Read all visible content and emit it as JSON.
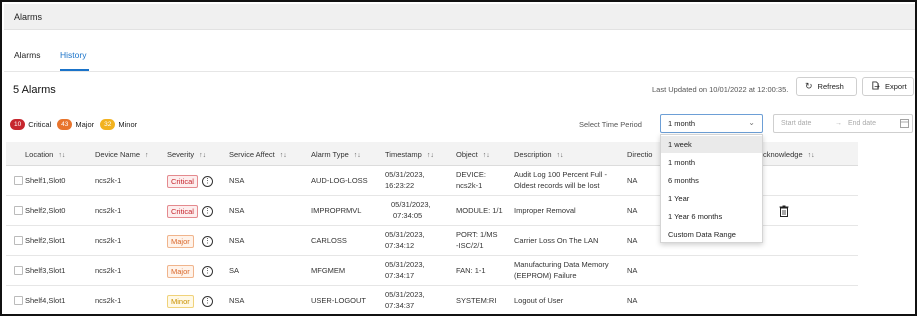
{
  "window": {
    "title": "Alarms"
  },
  "tabs": [
    {
      "label": "Alarms",
      "active": false
    },
    {
      "label": "History",
      "active": true
    }
  ],
  "summary": {
    "count_title": "5 Alarms",
    "last_updated": "Last Updated on 10/01/2022 at 12:00:35."
  },
  "toolbar": {
    "refresh_label": "Refresh",
    "refresh_icon": "refresh-icon",
    "export_label": "Export",
    "export_icon": "export-icon"
  },
  "severity_counts": [
    {
      "count": "10",
      "label": "Critical",
      "color": "#c6262e"
    },
    {
      "count": "43",
      "label": "Major",
      "color": "#e8742c"
    },
    {
      "count": "32",
      "label": "Minor",
      "color": "#f2b21e"
    }
  ],
  "time_period": {
    "label": "Select Time Period",
    "selected": "1 month",
    "options": [
      "1 week",
      "1 month",
      "6 months",
      "1 Year",
      "1 Year 6 months",
      "Custom Data Range"
    ],
    "highlighted_index": 0
  },
  "date_range": {
    "start_placeholder": "Start date",
    "separator": "→",
    "end_placeholder": "End date"
  },
  "table": {
    "columns": [
      "Location",
      "Device Name",
      "Severity",
      "Service Affect",
      "Alarm Type",
      "Timestamp",
      "Object",
      "Description",
      "Direction",
      "Acknowledge"
    ],
    "direction_visible": "Directio",
    "acknowledge_visible": "cknowledge",
    "rows": [
      {
        "location": "Shelf1,Slot0",
        "device": "ncs2k-1",
        "severity": "Critical",
        "service_affect": "NSA",
        "alarm_type": "AUD-LOG-LOSS",
        "timestamp_date": "05/31/2023,",
        "timestamp_time": "16:23:22",
        "object_l1": "DEVICE:",
        "object_l2": "ncs2k-1",
        "desc_l1": "Audit Log 100 Percent Full -",
        "desc_l2": "Oldest records will be lost",
        "direction": "NA"
      },
      {
        "location": "Shelf2,Slot0",
        "device": "ncs2k-1",
        "severity": "Critical",
        "service_affect": "NSA",
        "alarm_type": "IMPROPRMVL",
        "timestamp_date": "05/31/2023,",
        "timestamp_time": "07:34:05",
        "object_l1": "MODULE: 1/1",
        "object_l2": "",
        "desc_l1": "Improper Removal",
        "desc_l2": "",
        "direction": "NA"
      },
      {
        "location": "Shelf2,Slot1",
        "device": "ncs2k-1",
        "severity": "Major",
        "service_affect": "NSA",
        "alarm_type": "CARLOSS",
        "timestamp_date": "05/31/2023,",
        "timestamp_time": "07:34:12",
        "object_l1": "PORT: 1/MS",
        "object_l2": "-ISC/2/1",
        "desc_l1": "Carrier Loss On The LAN",
        "desc_l2": "",
        "direction": "NA"
      },
      {
        "location": "Shelf3,Slot1",
        "device": "ncs2k-1",
        "severity": "Major",
        "service_affect": "SA",
        "alarm_type": "MFGMEM",
        "timestamp_date": "05/31/2023,",
        "timestamp_time": "07:34:17",
        "object_l1": "FAN: 1-1",
        "object_l2": "",
        "desc_l1": "Manufacturing Data Memory",
        "desc_l2": "(EEPROM) Failure",
        "direction": "NA"
      },
      {
        "location": "Shelf4,Slot1",
        "device": "ncs2k-1",
        "severity": "Minor",
        "service_affect": "NSA",
        "alarm_type": "USER-LOGOUT",
        "timestamp_date": "05/31/2023,",
        "timestamp_time": "07:34:37",
        "object_l1": "SYSTEM:RI",
        "object_l2": "",
        "desc_l1": "Logout of User",
        "desc_l2": "",
        "direction": "NA"
      }
    ]
  },
  "icons": {
    "sort": "sort-icon",
    "info": "info-circle-icon",
    "dropdown": "chevron-down-icon",
    "calendar": "calendar-icon",
    "acknowledge_action": "trash-icon"
  }
}
